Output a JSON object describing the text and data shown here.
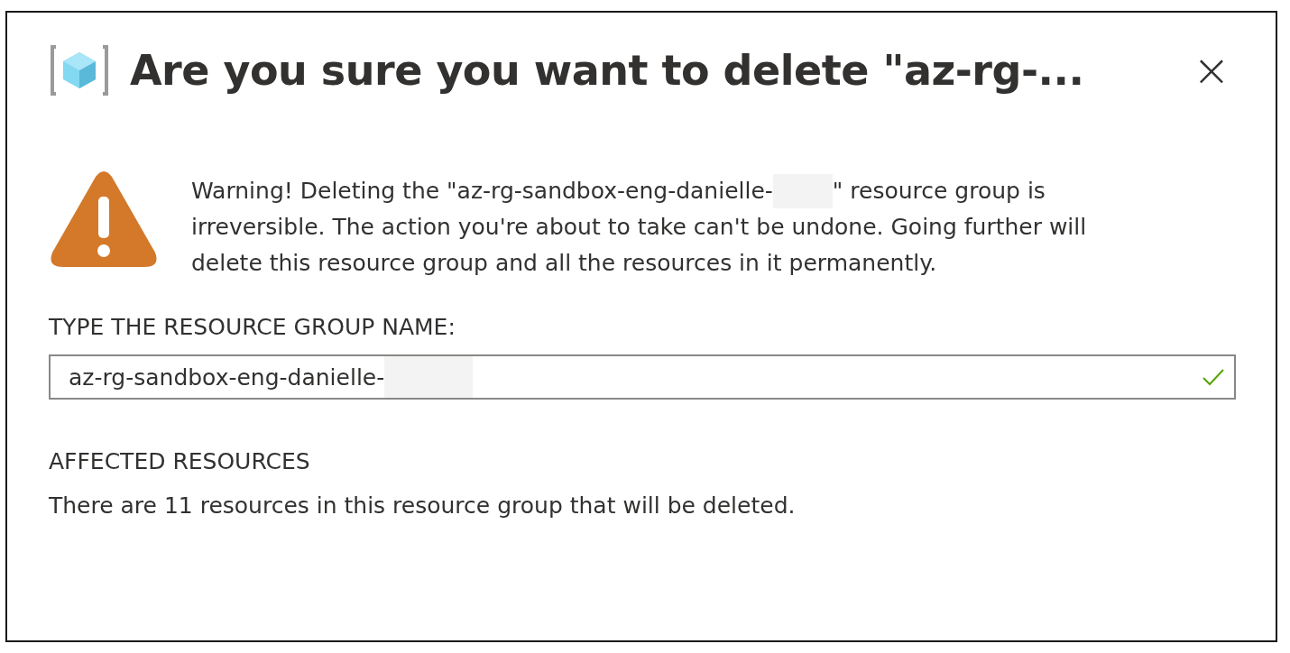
{
  "dialog": {
    "title": "Are you sure you want to delete \"az-rg-...",
    "close": "×"
  },
  "warning": {
    "line_1_before": "Warning! Deleting the \"az-rg-sandbox-eng-danielle-",
    "line_1_after": "\" resource group is",
    "line_2": "irreversible. The action you're about to take can't be undone. Going further will",
    "line_3": "delete this resource group and all the resources in it permanently."
  },
  "name_field": {
    "label": "TYPE THE RESOURCE GROUP NAME:",
    "value": "az-rg-sandbox-eng-danielle-",
    "valid": true
  },
  "affected": {
    "heading": "AFFECTED RESOURCES",
    "text": "There are 11 resources in this resource group that will be deleted."
  }
}
